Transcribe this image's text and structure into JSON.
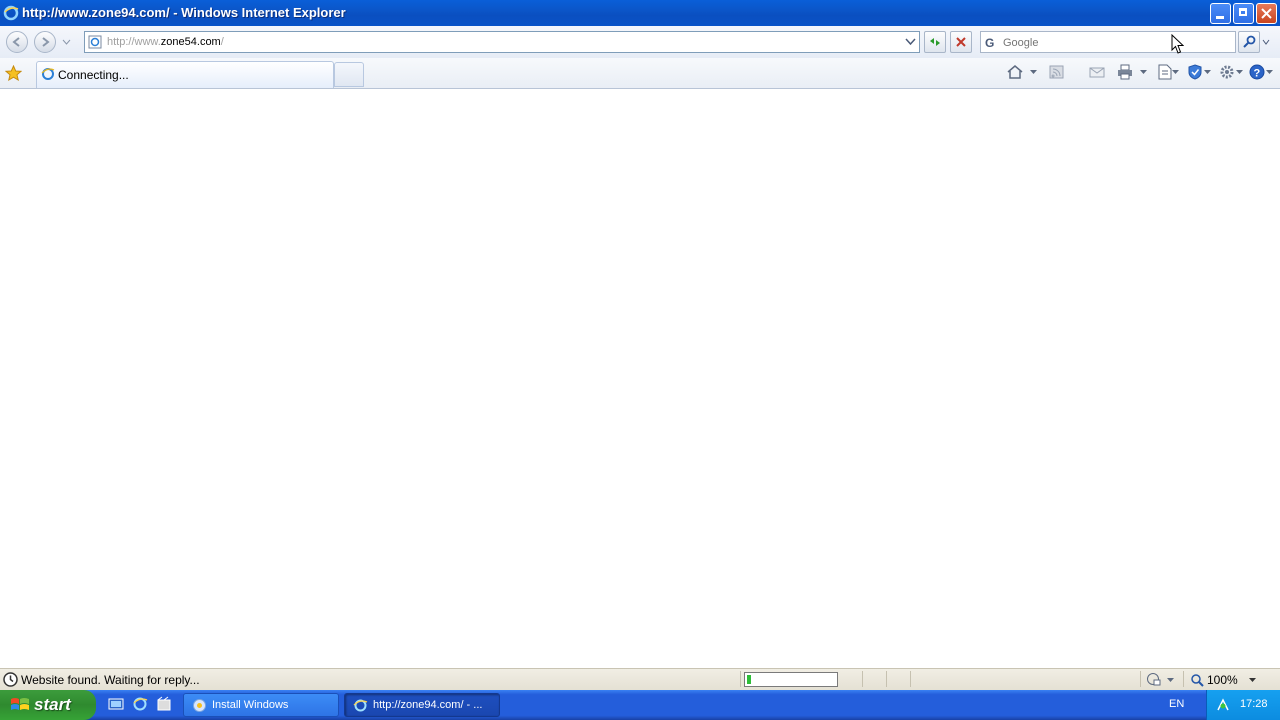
{
  "window": {
    "title": "http://www.zone94.com/ - Windows Internet Explorer"
  },
  "address": {
    "prefix": "http://www.",
    "domain": "zone54.com",
    "suffix": "/"
  },
  "search": {
    "placeholder": "Google"
  },
  "tabs": [
    {
      "label": "Connecting..."
    }
  ],
  "status": {
    "message": "Website found. Waiting for reply...",
    "progress": 0.04,
    "zoom": "100%"
  },
  "taskbar": {
    "start_label": "start",
    "buttons": [
      {
        "label": "Install Windows"
      },
      {
        "label": "http://zone94.com/ - ..."
      }
    ],
    "lang": "EN",
    "clock": "17:28"
  },
  "colors": {
    "titlebar": "#0a55c8",
    "taskbar": "#245edb",
    "start": "#2f8a2f",
    "progress": "#2fbd38"
  },
  "icons": [
    "ie-icon",
    "back-icon",
    "forward-icon",
    "refresh-icon",
    "stop-icon",
    "favorites-star-icon",
    "home-icon",
    "feeds-icon",
    "mail-icon",
    "print-icon",
    "page-icon",
    "safety-icon",
    "tools-icon",
    "help-icon",
    "search-icon",
    "zoom-icon",
    "globe-icon",
    "windows-logo-icon"
  ]
}
